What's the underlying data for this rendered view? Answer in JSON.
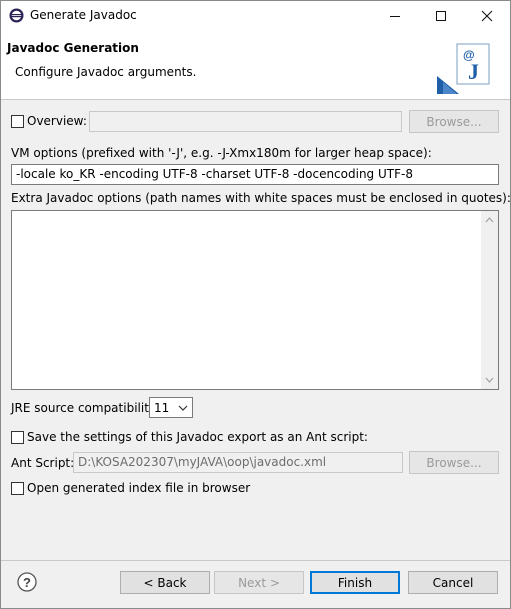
{
  "window": {
    "title": "Generate Javadoc"
  },
  "header": {
    "title": "Javadoc Generation",
    "description": "Configure Javadoc arguments."
  },
  "overview": {
    "label": "Overview:",
    "checked": false,
    "value": "",
    "browse_label": "Browse..."
  },
  "vm_options": {
    "label": "VM options (prefixed with '-J', e.g. -J-Xmx180m for larger heap space):",
    "value": "-locale ko_KR -encoding UTF-8 -charset UTF-8 -docencoding UTF-8"
  },
  "extra_options": {
    "label": "Extra Javadoc options (path names with white spaces must be enclosed in quotes):",
    "value": ""
  },
  "jre": {
    "label": "JRE source compatibility:",
    "value": "11"
  },
  "ant": {
    "save_label": "Save the settings of this Javadoc export as an Ant script:",
    "save_checked": false,
    "script_label": "Ant Script:",
    "script_value": "D:\\KOSA202307\\myJAVA\\oop\\javadoc.xml",
    "browse_label": "Browse..."
  },
  "open_index": {
    "label": "Open generated index file in browser",
    "checked": false
  },
  "footer": {
    "back_label": "< Back",
    "next_label": "Next >",
    "finish_label": "Finish",
    "cancel_label": "Cancel"
  },
  "icons": {
    "app": "eclipse-icon",
    "help": "help-icon",
    "banner": "javadoc-banner-icon"
  },
  "colors": {
    "accent": "#0078d7",
    "banner_blue": "#1f5fa8"
  }
}
